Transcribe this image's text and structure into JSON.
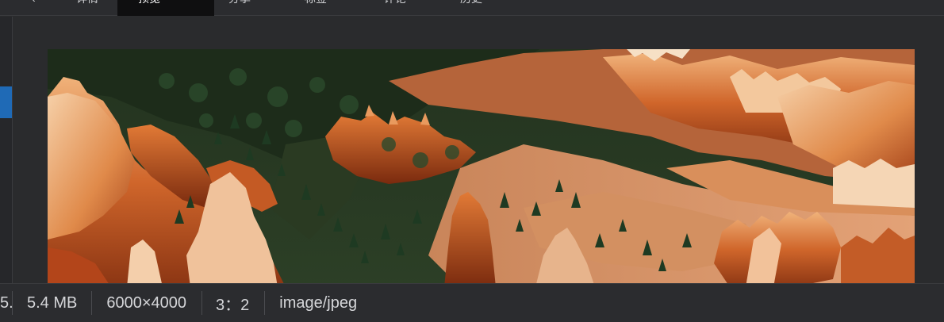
{
  "tabs": [
    {
      "label": "详情",
      "active": false
    },
    {
      "label": "预览",
      "active": true
    },
    {
      "label": "分享",
      "active": false
    },
    {
      "label": "标签",
      "active": false
    },
    {
      "label": "评论",
      "active": false
    },
    {
      "label": "历史",
      "active": false
    }
  ],
  "sidebar": {
    "items": [
      {
        "label": "•",
        "selected": false
      },
      {
        "label": "•",
        "selected": false
      },
      {
        "label": "",
        "selected": true
      }
    ]
  },
  "preview": {
    "image_alt": "Bryce Canyon hoodoos panorama"
  },
  "status": {
    "truncated": "5.",
    "file_size": "5.4 MB",
    "dimensions": "6000×4000",
    "aspect_ratio": "3：2",
    "mime_type": "image/jpeg"
  },
  "colors": {
    "background": "#2a2b2d",
    "active_tab": "#0f0f10",
    "selected_sidebar": "#1f6ab6",
    "status_text": "#d5d6d9"
  }
}
